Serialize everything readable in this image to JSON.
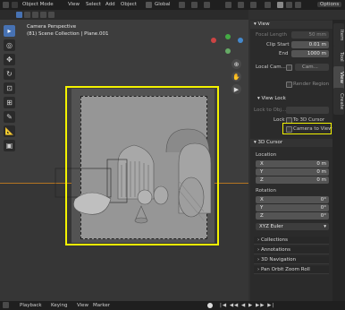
{
  "header": {
    "mode": "Object Mode",
    "menus": [
      "View",
      "Select",
      "Add",
      "Object"
    ],
    "transform": "Global",
    "options": "Options"
  },
  "viewport": {
    "title": "Camera Perspective",
    "collection": "(81) Scene Collection | Plane.001"
  },
  "tabs": [
    "Item",
    "Tool",
    "View",
    "Create"
  ],
  "panel": {
    "view_header": "View",
    "focal_length_label": "Focal Length",
    "focal_length_value": "50 mm",
    "clip_start_label": "Clip Start",
    "clip_start_value": "0.01 m",
    "end_label": "End",
    "end_value": "1000 m",
    "local_camera_label": "Local Cam...",
    "local_camera_value": "Cam...",
    "render_region": "Render Region",
    "view_lock_header": "View Lock",
    "lock_to_object_label": "Lock to Obj...",
    "lock_label": "Lock",
    "to_3d_cursor": "To 3D Cursor",
    "camera_to_view": "Camera to View",
    "cursor_header": "3D Cursor",
    "location_label": "Location",
    "loc_x_label": "X",
    "loc_x_value": "0 m",
    "loc_y_label": "Y",
    "loc_y_value": "0 m",
    "loc_z_label": "Z",
    "loc_z_value": "0 m",
    "rotation_label": "Rotation",
    "rot_x_label": "X",
    "rot_x_value": "0°",
    "rot_y_label": "Y",
    "rot_y_value": "0°",
    "rot_z_label": "Z",
    "rot_z_value": "0°",
    "euler": "XYZ Euler",
    "collections": "Collections",
    "annotations": "Annotations",
    "navigation": "3D Navigation",
    "pan_orbit": "Pan Orbit Zoom Roll"
  },
  "footer": {
    "playback": "Playback",
    "keying": "Keying",
    "view": "View",
    "marker": "Marker"
  },
  "colors": {
    "highlight": "#f4f300",
    "accent": "#4772b3",
    "horizon": "#b47522"
  }
}
